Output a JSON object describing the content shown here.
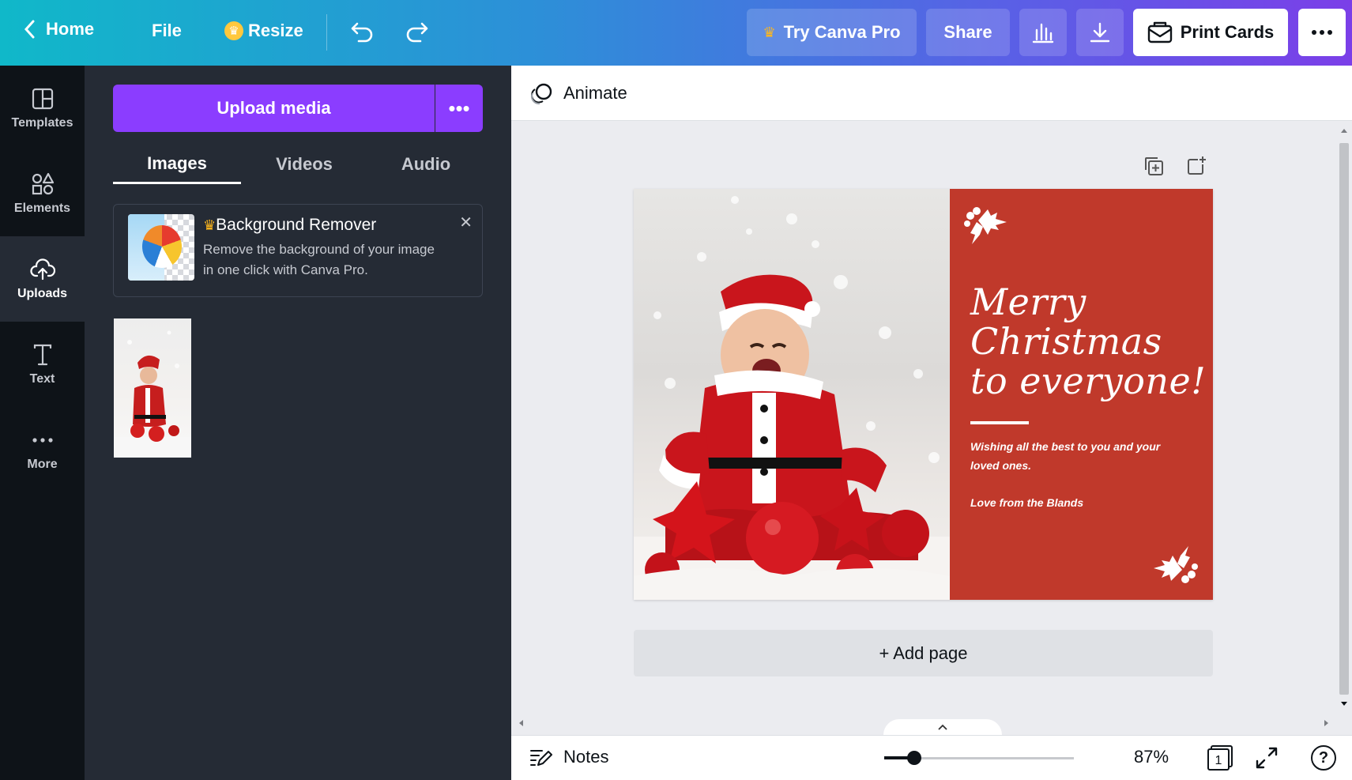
{
  "topbar": {
    "home_label": "Home",
    "file_label": "File",
    "resize_label": "Resize",
    "try_pro_label": "Try Canva Pro",
    "share_label": "Share",
    "print_label": "Print Cards",
    "icons": [
      "chevron-left-icon",
      "crown-icon",
      "undo-icon",
      "redo-icon",
      "insights-icon",
      "download-icon",
      "envelope-icon",
      "more-icon"
    ]
  },
  "rail": {
    "items": [
      {
        "label": "Templates",
        "icon": "templates-icon"
      },
      {
        "label": "Elements",
        "icon": "elements-icon"
      },
      {
        "label": "Uploads",
        "icon": "cloud-upload-icon",
        "active": true
      },
      {
        "label": "Text",
        "icon": "text-icon"
      },
      {
        "label": "More",
        "icon": "more-dots-icon"
      }
    ]
  },
  "panel": {
    "upload_label": "Upload media",
    "more_label": "•••",
    "tabs": [
      {
        "label": "Images",
        "active": true
      },
      {
        "label": "Videos"
      },
      {
        "label": "Audio"
      }
    ],
    "promo": {
      "title": "Background Remover",
      "description": "Remove the background of your image in one click with Canva Pro.",
      "close": "✕"
    }
  },
  "editor": {
    "animate_label": "Animate",
    "add_page_label": "+ Add page"
  },
  "card": {
    "headline": [
      "Merry",
      "Christmas",
      "to everyone!"
    ],
    "wish": "Wishing all the best to you and your loved ones.",
    "signoff": "Love from the Blands",
    "bg_color": "#c0392b"
  },
  "bottombar": {
    "notes_label": "Notes",
    "zoom": "87%",
    "page_count": "1",
    "help": "?",
    "zoom_fraction": 0.16
  },
  "colors": {
    "accent": "#8b3dff",
    "panel": "#252b35",
    "rail": "#0e1318",
    "crown": "#ffc83d"
  }
}
